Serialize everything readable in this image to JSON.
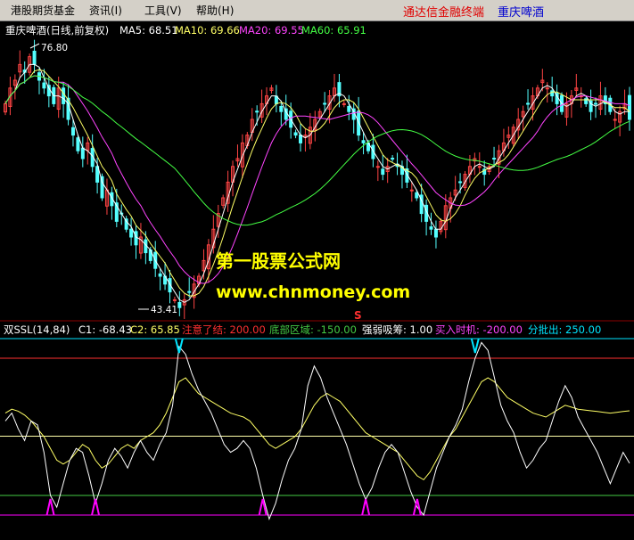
{
  "menu": {
    "items": [
      "港股期货基金",
      "资讯(I)",
      "工具(V)",
      "帮助(H)"
    ],
    "right_link": "通达信金融终端",
    "right_title": "重庆啤酒"
  },
  "colors": {
    "up": "#ff4444",
    "down": "#54ffff",
    "ma5": "#ffffff",
    "ma10": "#ffff66",
    "ma20": "#ff44ff",
    "ma60": "#44ff44",
    "cyan": "#00e5ff",
    "red": "#ff3030",
    "green": "#44cc44",
    "magenta": "#ff00ff"
  },
  "main_panel": {
    "title": "重庆啤酒(日线,前复权)",
    "ma5": "MA5: 68.51",
    "ma10": "MA10: 69.66",
    "ma20": "MA20: 69.55",
    "ma60": "MA60: 65.91",
    "high_marker": "76.80",
    "low_marker": "43.41",
    "watermark_line1": "第一股票公式网",
    "watermark_line2": "www.chnmoney.com",
    "signal_marker": "S"
  },
  "indicator_panel": {
    "name": "双SSL(14,84)",
    "c1": "C1: -68.43",
    "c2": "C2: 65.85",
    "label_top": "注意了结: 200.00",
    "label_bottom": "底部区域: -150.00",
    "label_mid": "强弱吸筹: 1.00",
    "label_buy": "买入时机: -200.00",
    "label_sell": "分批出: 250.00"
  },
  "chart_data": [
    {
      "type": "candlestick",
      "title": "重庆啤酒(日线,前复权)",
      "ylim": [
        43,
        78
      ],
      "annotations": [
        {
          "label": "76.80",
          "value": 76.8
        },
        {
          "label": "43.41",
          "value": 43.41
        }
      ],
      "series": [
        {
          "name": "MA5",
          "last": 68.51
        },
        {
          "name": "MA10",
          "last": 69.66
        },
        {
          "name": "MA20",
          "last": 69.55
        },
        {
          "name": "MA60",
          "last": 65.91
        }
      ],
      "close": [
        70,
        72,
        73,
        75,
        74,
        76,
        75,
        73,
        72,
        71,
        70,
        72,
        70,
        68,
        66,
        64,
        63,
        65,
        62,
        60,
        58,
        59,
        57,
        55,
        56,
        54,
        53,
        52,
        53,
        51,
        50,
        49,
        48,
        47,
        46,
        45,
        44,
        45,
        46,
        47,
        48,
        50,
        52,
        54,
        56,
        58,
        60,
        62,
        63,
        65,
        66,
        68,
        69,
        70,
        71,
        72,
        70,
        69,
        68,
        67,
        66,
        65,
        66,
        67,
        68,
        69,
        70,
        71,
        72,
        71,
        70,
        69,
        68,
        66,
        65,
        64,
        63,
        62,
        61,
        62,
        63,
        62,
        61,
        60,
        59,
        58,
        56,
        55,
        54,
        53,
        55,
        57,
        58,
        59,
        60,
        61,
        62,
        63,
        62,
        61,
        62,
        63,
        64,
        65,
        66,
        67,
        68,
        69,
        70,
        71,
        72,
        73,
        72,
        71,
        70,
        69,
        70,
        71,
        72,
        71,
        70,
        69,
        70,
        71,
        70,
        69,
        68,
        69,
        70,
        68
      ]
    },
    {
      "type": "line",
      "title": "双SSL(14,84)",
      "ylim": [
        -250,
        250
      ],
      "levels": [
        {
          "name": "注意了结",
          "value": 200
        },
        {
          "name": "底部区域",
          "value": -150
        },
        {
          "name": "强弱吸筹",
          "value": 1
        },
        {
          "name": "买入时机",
          "value": -200
        },
        {
          "name": "分批出",
          "value": 250
        }
      ],
      "series": [
        {
          "name": "C1",
          "last": -68.43,
          "values": [
            40,
            60,
            20,
            -10,
            40,
            30,
            -40,
            -150,
            -180,
            -120,
            -60,
            -30,
            -40,
            -100,
            -170,
            -120,
            -60,
            -30,
            -50,
            -80,
            -40,
            -10,
            -40,
            -60,
            -20,
            10,
            80,
            230,
            210,
            160,
            120,
            90,
            60,
            20,
            -20,
            -40,
            -30,
            -10,
            -30,
            -80,
            -150,
            -210,
            -170,
            -110,
            -60,
            -30,
            20,
            130,
            180,
            150,
            100,
            60,
            20,
            -20,
            -70,
            -120,
            -160,
            -130,
            -80,
            -40,
            -20,
            -40,
            -90,
            -140,
            -180,
            -200,
            -140,
            -80,
            -40,
            0,
            30,
            70,
            140,
            200,
            240,
            220,
            150,
            80,
            40,
            10,
            -40,
            -80,
            -60,
            -30,
            -10,
            40,
            90,
            130,
            100,
            50,
            20,
            -10,
            -40,
            -80,
            -120,
            -80,
            -40,
            -68
          ]
        },
        {
          "name": "C2",
          "last": 65.85,
          "values": [
            60,
            70,
            65,
            55,
            40,
            20,
            0,
            -30,
            -60,
            -70,
            -60,
            -40,
            -20,
            -30,
            -60,
            -80,
            -70,
            -50,
            -30,
            -20,
            -30,
            -10,
            0,
            10,
            30,
            60,
            100,
            140,
            150,
            130,
            110,
            100,
            90,
            80,
            70,
            60,
            55,
            50,
            40,
            20,
            0,
            -20,
            -30,
            -20,
            -10,
            0,
            20,
            50,
            80,
            100,
            110,
            100,
            90,
            70,
            50,
            30,
            10,
            0,
            -10,
            -20,
            -30,
            -40,
            -60,
            -80,
            -100,
            -110,
            -90,
            -60,
            -30,
            0,
            20,
            50,
            80,
            110,
            140,
            150,
            140,
            120,
            100,
            90,
            80,
            70,
            60,
            55,
            50,
            60,
            70,
            80,
            75,
            70,
            68,
            66,
            64,
            62,
            60,
            62,
            64,
            66
          ]
        }
      ]
    }
  ]
}
